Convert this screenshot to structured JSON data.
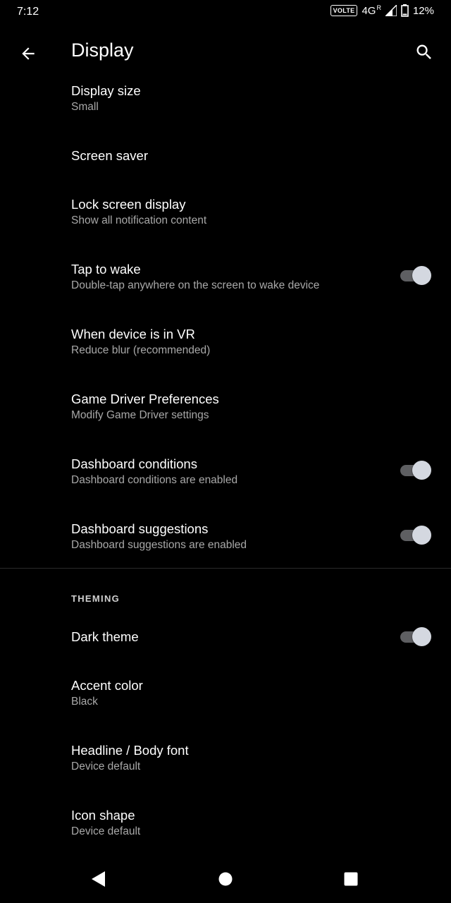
{
  "status_bar": {
    "time": "7:12",
    "volte": "VOLTE",
    "network": "4G",
    "roaming": "R",
    "battery_percent": "12%",
    "battery_level": 0.12,
    "signal_icon": "signal-icon",
    "battery_icon": "battery-icon"
  },
  "app_bar": {
    "title": "Display",
    "back_icon": "arrow-back-icon",
    "search_icon": "search-icon"
  },
  "settings": [
    {
      "title": "Display size",
      "summary": "Small"
    },
    {
      "title": "Screen saver",
      "summary": ""
    },
    {
      "title": "Lock screen display",
      "summary": "Show all notification content"
    },
    {
      "title": "Tap to wake",
      "summary": "Double-tap anywhere on the screen to wake device",
      "toggle": true
    },
    {
      "title": "When device is in VR",
      "summary": "Reduce blur (recommended)"
    },
    {
      "title": "Game Driver Preferences",
      "summary": "Modify Game Driver settings"
    },
    {
      "title": "Dashboard conditions",
      "summary": "Dashboard conditions are enabled",
      "toggle": true
    },
    {
      "title": "Dashboard suggestions",
      "summary": "Dashboard suggestions are enabled",
      "toggle": true
    }
  ],
  "theming": {
    "header": "THEMING",
    "items": [
      {
        "title": "Dark theme",
        "summary": "",
        "toggle": true
      },
      {
        "title": "Accent color",
        "summary": "Black"
      },
      {
        "title": "Headline / Body font",
        "summary": "Device default"
      },
      {
        "title": "Icon shape",
        "summary": "Device default"
      }
    ]
  },
  "nav_bar": {
    "back_icon": "nav-back-icon",
    "home_icon": "nav-home-icon",
    "recents_icon": "nav-recents-icon"
  },
  "colors": {
    "background": "#000000",
    "text_primary": "#ffffff",
    "text_secondary": "#a8a8a8",
    "toggle_thumb": "#d4d8e0",
    "toggle_track": "#5e5f62"
  }
}
